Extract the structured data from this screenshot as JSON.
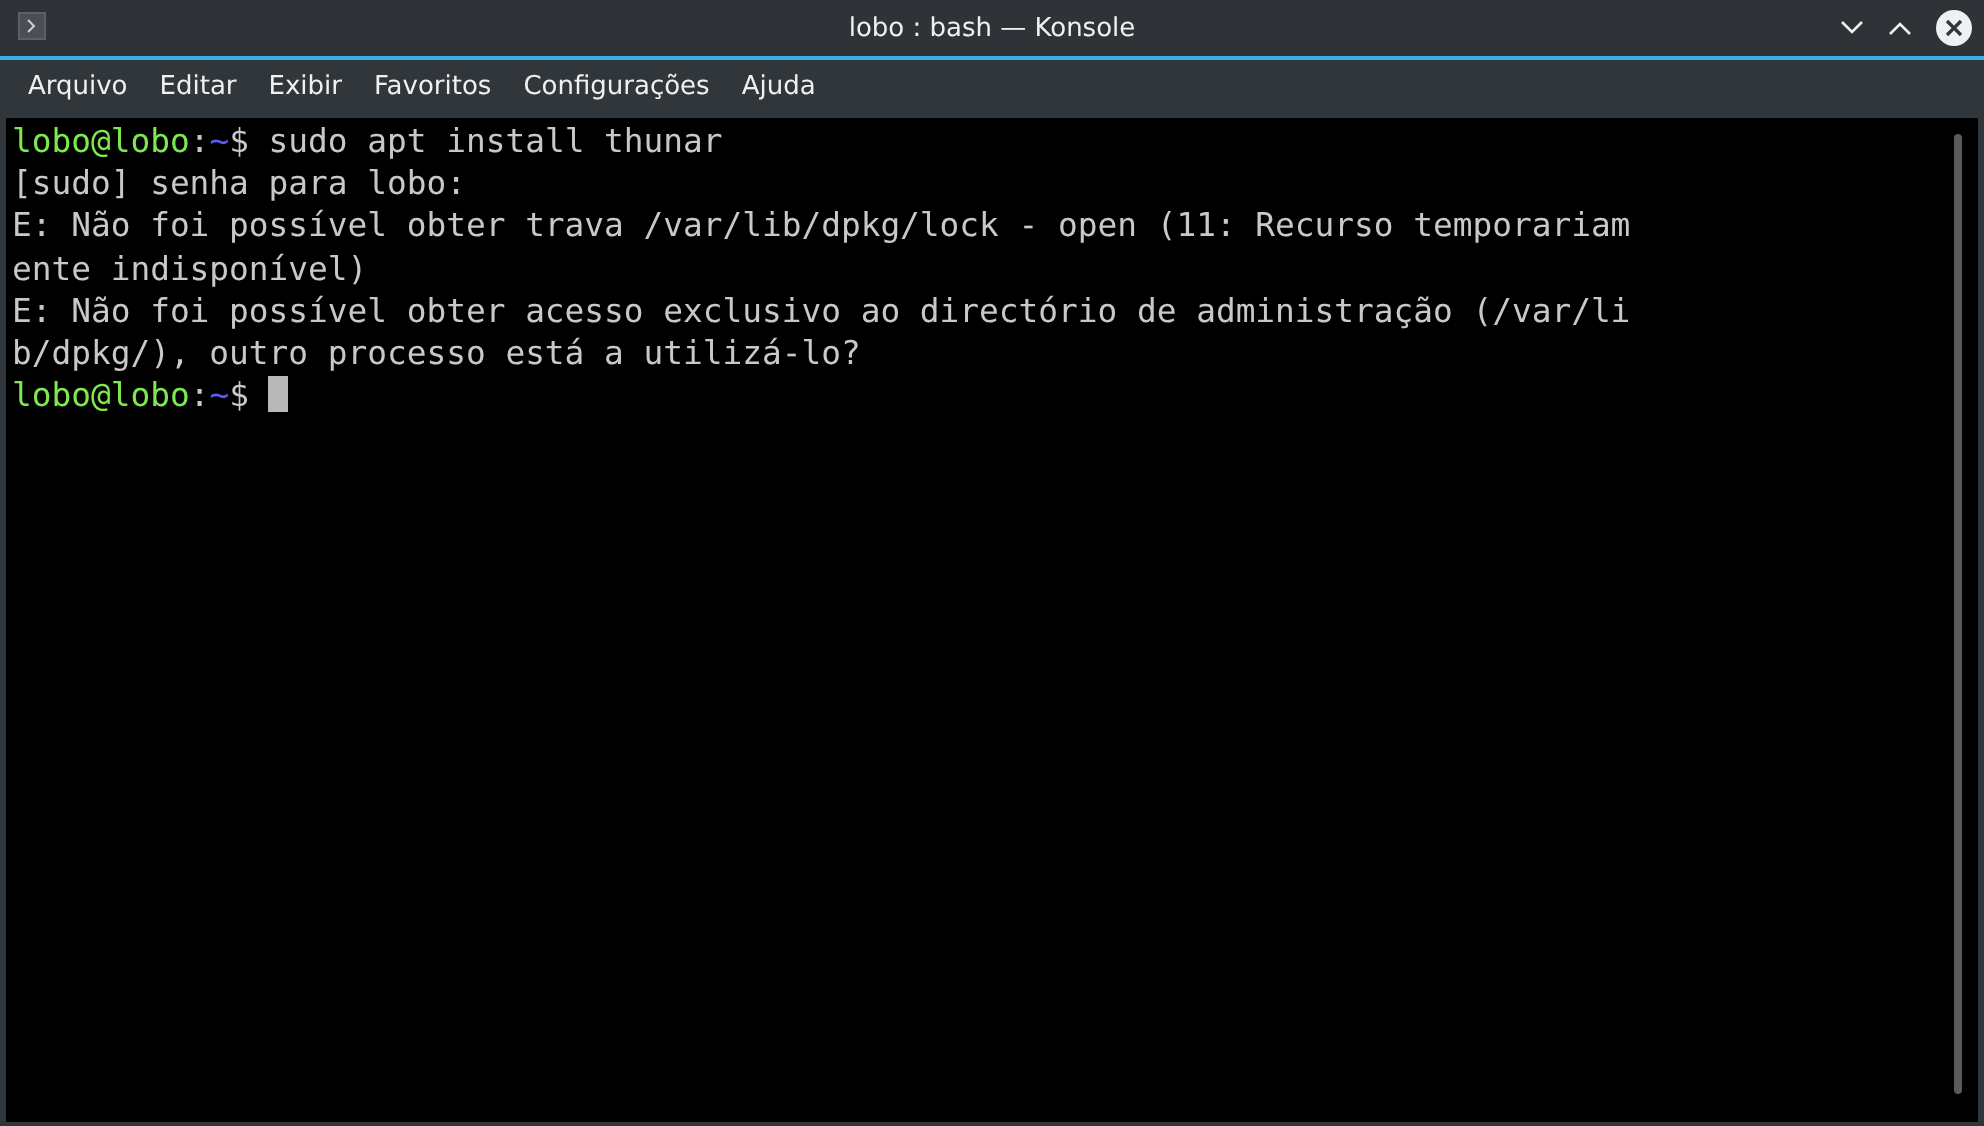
{
  "window": {
    "title": "lobo : bash — Konsole"
  },
  "menu": [
    "Arquivo",
    "Editar",
    "Exibir",
    "Favoritos",
    "Configurações",
    "Ajuda"
  ],
  "terminal": {
    "lines": [
      {
        "kind": "prompt",
        "user_host": "lobo@lobo",
        "separator": ":",
        "path": "~",
        "symbol": "$",
        "command": " sudo apt install thunar"
      },
      {
        "kind": "output",
        "text": "[sudo] senha para lobo:"
      },
      {
        "kind": "output",
        "text": "E: Não foi possível obter trava /var/lib/dpkg/lock - open (11: Recurso temporariam"
      },
      {
        "kind": "output",
        "text": "ente indisponível)"
      },
      {
        "kind": "output",
        "text": "E: Não foi possível obter acesso exclusivo ao directório de administração (/var/li"
      },
      {
        "kind": "output",
        "text": "b/dpkg/), outro processo está a utilizá-lo?"
      },
      {
        "kind": "prompt",
        "user_host": "lobo@lobo",
        "separator": ":",
        "path": "~",
        "symbol": "$",
        "cursor": true
      }
    ]
  }
}
